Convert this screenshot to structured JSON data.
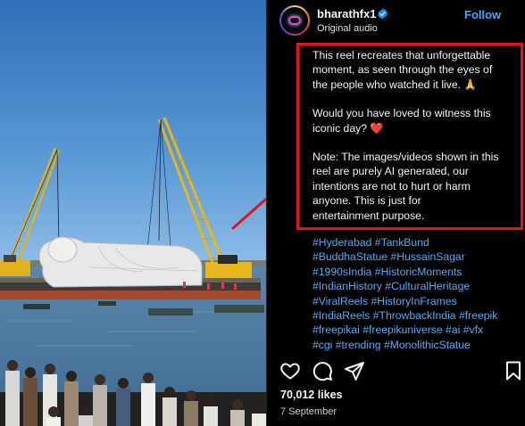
{
  "post": {
    "username": "bharathfx1",
    "audio": "Original audio",
    "follow_label": "Follow",
    "caption_1": "This reel recreates that unforgettable\nmoment, as seen through the eyes of\nthe people who watched it live. 🙏",
    "caption_2": "Would you have loved to witness this\niconic day? ",
    "caption_heart": "❤️",
    "caption_3": "Note: The images/videos shown in this\nreel are purely AI generated, our\nintentions are not to hurt or harm\nanyone. This is just for\nentertainment purpose.",
    "hashtags": [
      "#Hyderabad #TankBund",
      "#BuddhaStatue #HussainSagar",
      "#1990sIndia #HistoricMoments",
      "#IndianHistory #CulturalHeritage",
      "#ViralReels #HistoryInFrames",
      "#IndiaReels #ThrowbackIndia #freepik",
      "#freepikai #freepikuniverse #ai #vfx",
      "#cgi #trending #MonolithicStatue"
    ],
    "likes": "70,012 likes",
    "date": "7 September"
  },
  "icons": {
    "like": "heart-icon",
    "comment": "comment-icon",
    "share": "share-icon",
    "save": "bookmark-icon",
    "verified": "verified-badge-icon"
  },
  "colors": {
    "follow": "#4ca6ff",
    "hashtag": "#5fa8f0",
    "annotation": "#e5141a",
    "verified": "#0095f6"
  }
}
